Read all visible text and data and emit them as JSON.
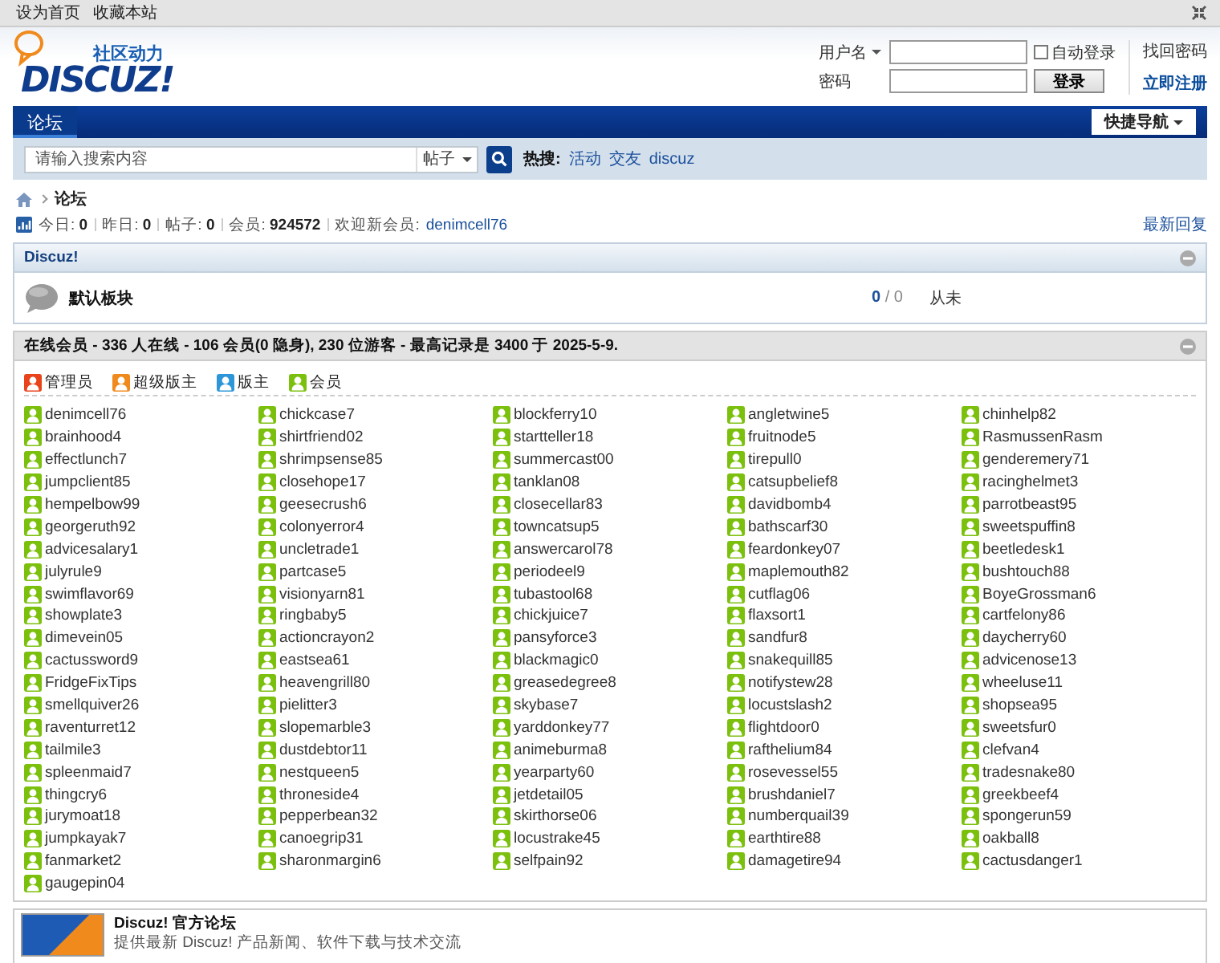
{
  "top_links": [
    "设为首页",
    "收藏本站"
  ],
  "logo": {
    "tagline": "社区动力",
    "wordmark": "DISCUZ!"
  },
  "login": {
    "username_label": "用户名",
    "password_label": "密码",
    "auto_login": {
      "label": "自动登录",
      "checked": false
    },
    "login_button": "登录",
    "find_password": "找回密码",
    "register": "立即注册"
  },
  "nav": {
    "tabs": [
      {
        "label": "论坛",
        "selected": true
      }
    ],
    "quick_nav": "快捷导航"
  },
  "search": {
    "placeholder": "请输入搜索内容",
    "type": "帖子",
    "hot_label": "热搜:",
    "hot": [
      "活动",
      "交友",
      "discuz"
    ]
  },
  "breadcrumb": [
    "论坛"
  ],
  "stats": [
    {
      "label": "今日:",
      "value": "0"
    },
    {
      "label": "昨日:",
      "value": "0"
    },
    {
      "label": "帖子:",
      "value": "0"
    },
    {
      "label": "会员:",
      "value": "924572"
    }
  ],
  "new_member_label": "欢迎新会员:",
  "new_member": "denimcell76",
  "latest_replies": "最新回复",
  "forum_group": {
    "title": "Discuz!",
    "forums": [
      {
        "name": "默认板块",
        "threads": "0",
        "separator": "/",
        "posts": "0",
        "last_post": "从未"
      }
    ]
  },
  "online": {
    "title": "在线会员 - 336 人在线 - 106 会员(0 隐身), 230 位游客 - 最高记录是 3400 于 2025-5-9.",
    "legend": [
      {
        "label": "管理员",
        "color": "#e8431a"
      },
      {
        "label": "超级版主",
        "color": "#f08a1c"
      },
      {
        "label": "版主",
        "color": "#2c96d8"
      },
      {
        "label": "会员",
        "color": "#7cc00e"
      }
    ],
    "members": [
      "denimcell76",
      "chickcase7",
      "blockferry10",
      "angletwine5",
      "chinhelp82",
      "brainhood4",
      "shirtfriend02",
      "startteller18",
      "fruitnode5",
      "RasmussenRasm",
      "effectlunch7",
      "shrimpsense85",
      "summercast00",
      "tirepull0",
      "genderemery71",
      "jumpclient85",
      "closehope17",
      "tanklan08",
      "catsupbelief8",
      "racinghelmet3",
      "hempelbow99",
      "geesecrush6",
      "closecellar83",
      "davidbomb4",
      "parrotbeast95",
      "georgeruth92",
      "colonyerror4",
      "towncatsup5",
      "bathscarf30",
      "sweetspuffin8",
      "advicesalary1",
      "uncletrade1",
      "answercarol78",
      "feardonkey07",
      "beetledesk1",
      "julyrule9",
      "partcase5",
      "periodeel9",
      "maplemouth82",
      "bushtouch88",
      "swimflavor69",
      "visionyarn81",
      "tubastool68",
      "cutflag06",
      "BoyeGrossman6",
      "showplate3",
      "ringbaby5",
      "chickjuice7",
      "flaxsort1",
      "cartfelony86",
      "dimevein05",
      "actioncrayon2",
      "pansyforce3",
      "sandfur8",
      "daycherry60",
      "cactussword9",
      "eastsea61",
      "blackmagic0",
      "snakequill85",
      "advicenose13",
      "FridgeFixTips",
      "heavengrill80",
      "greasedegree8",
      "notifystew28",
      "wheeluse11",
      "smellquiver26",
      "pielitter3",
      "skybase7",
      "locustslash2",
      "shopsea95",
      "raventurret12",
      "slopemarble3",
      "yarddonkey77",
      "flightdoor0",
      "sweetsfur0",
      "tailmile3",
      "dustdebtor11",
      "animeburma8",
      "rafthelium84",
      "clefvan4",
      "spleenmaid7",
      "nestqueen5",
      "yearparty60",
      "rosevessel55",
      "tradesnake80",
      "thingcry6",
      "throneside4",
      "jetdetail05",
      "brushdaniel7",
      "greekbeef4",
      "jurymoat18",
      "pepperbean32",
      "skirthorse06",
      "numberquail39",
      "spongerun59",
      "jumpkayak7",
      "canoegrip31",
      "locustrake45",
      "earthtire88",
      "oakball8",
      "fanmarket2",
      "sharonmargin6",
      "selfpain92",
      "damagetire94",
      "cactusdanger1",
      "gaugepin04"
    ]
  },
  "links": [
    {
      "name": "Discuz! 官方论坛",
      "description": "提供最新 Discuz! 产品新闻、软件下载与技术交流"
    }
  ]
}
